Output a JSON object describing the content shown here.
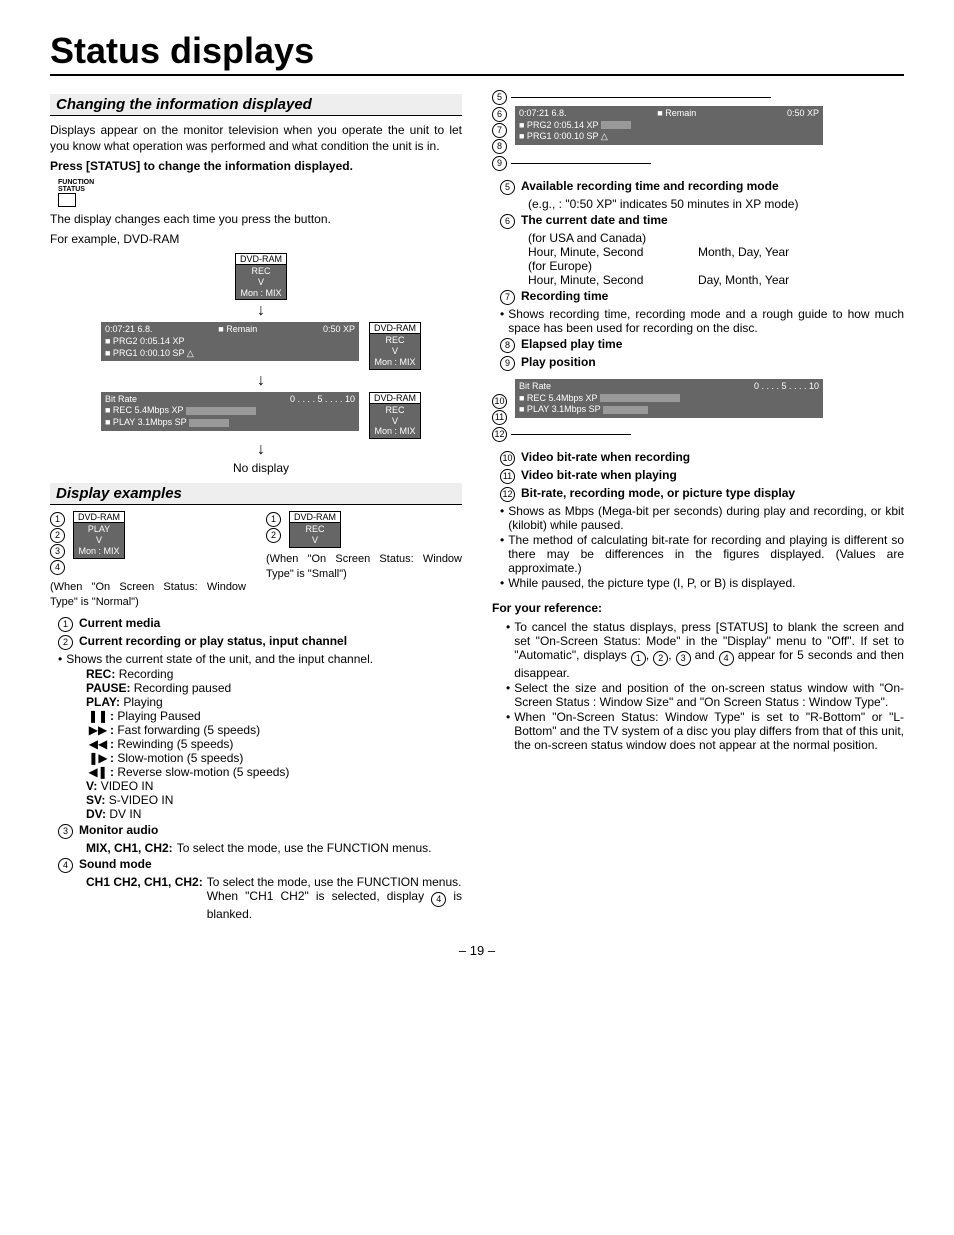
{
  "title": "Status displays",
  "section1": {
    "heading": "Changing the information displayed",
    "intro": "Displays appear on the monitor television when you operate the unit to let you know what operation was performed and what condition the unit is in.",
    "press": "Press [STATUS] to change the information displayed.",
    "funcLabel1": "FUNCTION",
    "funcLabel2": "STATUS",
    "changes": "The display changes each time you press the button.",
    "example": "For example, DVD-RAM",
    "dvdram": "DVD-RAM",
    "rec": "REC",
    "v": "V",
    "monmix": "Mon : MIX",
    "wide": {
      "l1a": "0:07:21  6.8.",
      "l1b": "■ Remain",
      "l1c": "0:50  XP",
      "l2": "■ PRG2  0:05.14  XP",
      "l3": "■ PRG1  0:00.10  SP  △"
    },
    "bitrate": {
      "hdr": "Bit Rate",
      "scale": "0 . . . . 5 . . . . 10",
      "l1": "■ REC  5.4Mbps  XP",
      "l2": "■ PLAY  3.1Mbps  SP"
    },
    "nodisplay": "No display"
  },
  "section2": {
    "heading": "Display examples",
    "normal": "(When \"On Screen Status: Window Type\" is \"Normal\")",
    "small": "(When \"On Screen Status: Window Type\" is \"Small\")",
    "play": "PLAY",
    "items": {
      "i1": "Current media",
      "i2": "Current recording or play status, input channel",
      "i2desc": "Shows the current state of the unit, and the input channel.",
      "rec": "REC:",
      "recD": "Recording",
      "pause": "PAUSE:",
      "pauseD": "Recording paused",
      "playL": "PLAY:",
      "playD": "Playing",
      "pp": "Playing Paused",
      "ff": "Fast forwarding (5 speeds)",
      "rw": "Rewinding (5 speeds)",
      "sm": "Slow-motion (5 speeds)",
      "rsm": "Reverse slow-motion (5 speeds)",
      "vL": "V:",
      "vD": "VIDEO IN",
      "svL": "SV:",
      "svD": "S-VIDEO IN",
      "dvL": "DV:",
      "dvD": "DV IN",
      "i3": "Monitor audio",
      "i3l": "MIX, CH1, CH2:",
      "i3d": "To select the mode, use the FUNCTION menus.",
      "i4": "Sound mode",
      "i4l": "CH1 CH2, CH1, CH2:",
      "i4d1": "To select the mode, use the FUNCTION menus.",
      "i4d2": "When \"CH1 CH2\" is selected, display",
      "i4d3": "is blanked."
    }
  },
  "right": {
    "i5": "Available recording time and recording mode",
    "i5d": "(e.g., : \"0:50 XP\" indicates 50 minutes in XP mode)",
    "i6": "The current date and time",
    "i6a": "(for USA and Canada)",
    "i6a1": "Hour, Minute, Second",
    "i6a2": "Month, Day, Year",
    "i6b": "(for Europe)",
    "i6b2": "Day, Month, Year",
    "i7": "Recording time",
    "i7d": "Shows recording time, recording mode and a rough guide to how much space has been used for recording on the disc.",
    "i8": "Elapsed play time",
    "i9": "Play position",
    "i10": "Video bit-rate when recording",
    "i11": "Video bit-rate when playing",
    "i12": "Bit-rate, recording mode, or picture type display",
    "i12a": "Shows as Mbps (Mega-bit per seconds) during play and recording, or kbit (kilobit) while paused.",
    "i12b": "The method of calculating bit-rate for recording and playing is different so there may be differences in the figures displayed. (Values are approximate.)",
    "i12c": "While paused, the picture type (I, P, or B) is displayed.",
    "ref": "For your reference:",
    "r1a": "To cancel the status displays, press [STATUS] to blank the screen and set \"On-Screen Status: Mode\" in the \"Display\" menu to \"Off\". If set to \"Automatic\", displays",
    "r1b": "appear for 5 seconds and then disappear.",
    "r2": "Select the size and position of the on-screen status window with \"On-Screen Status : Window Size\" and  \"On Screen Status : Window Type\".",
    "r3": "When \"On-Screen Status: Window Type\" is set to \"R-Bottom\" or \"L-Bottom\" and the TV system of a disc you play differs from that of this unit, the on-screen status window does not appear at the normal position.",
    "and": "and"
  },
  "page": "– 19 –"
}
